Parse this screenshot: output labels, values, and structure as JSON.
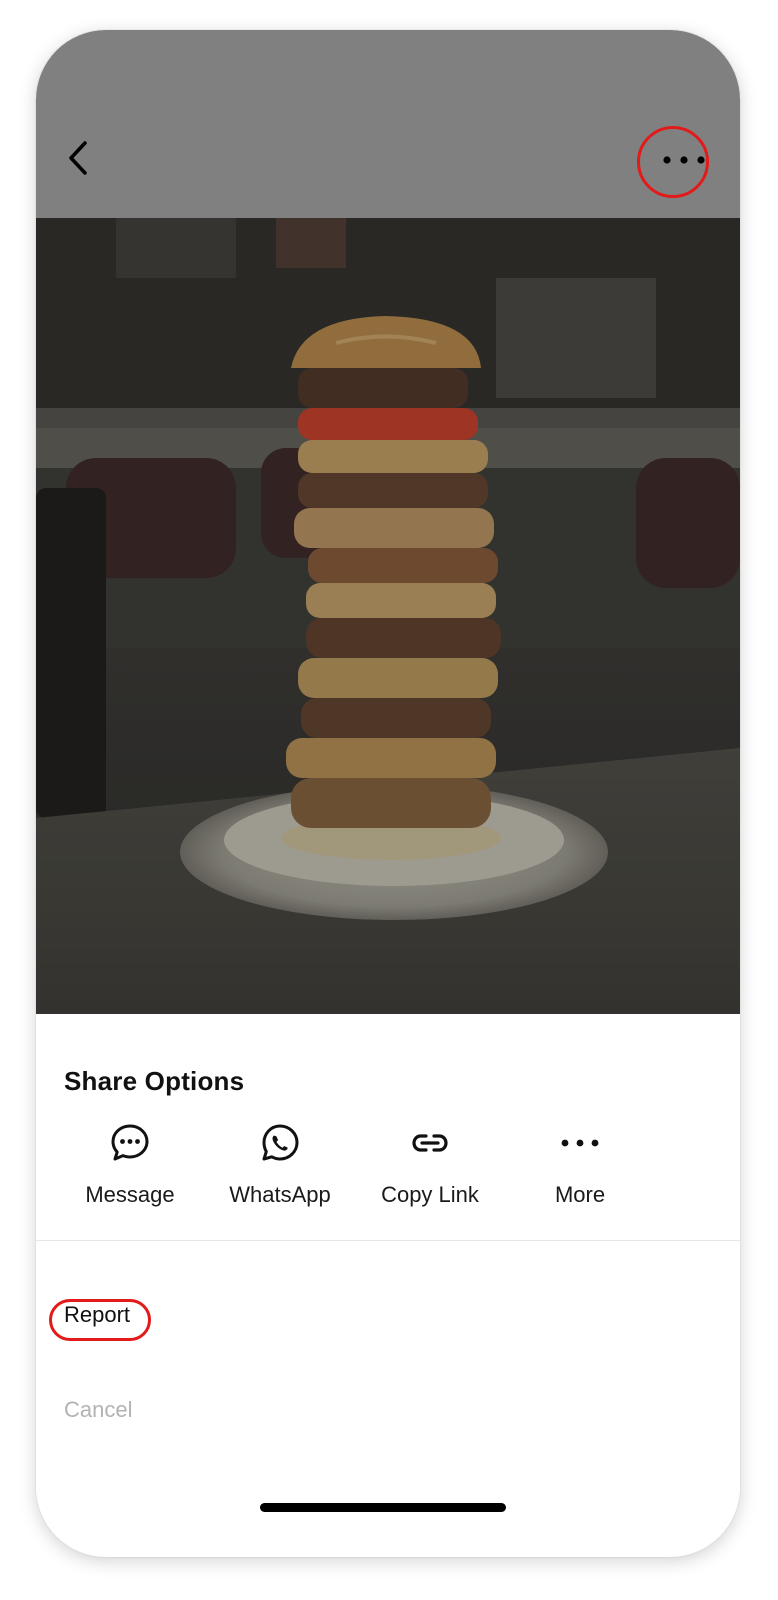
{
  "icons": {
    "back": "chevron-left-icon",
    "more": "more-horizontal-icon",
    "message": "message-bubble-icon",
    "whatsapp": "whatsapp-icon",
    "copy_link": "link-icon",
    "more_share": "more-horizontal-icon"
  },
  "colors": {
    "overlay_gray": "#808080",
    "highlight_red": "#e21a1a",
    "cancel_text": "#b3b3b3",
    "sheet_bg": "#ffffff"
  },
  "sheet": {
    "title": "Share Options",
    "share_options": [
      {
        "label": "Message"
      },
      {
        "label": "WhatsApp"
      },
      {
        "label": "Copy Link"
      },
      {
        "label": "More"
      }
    ],
    "report_label": "Report",
    "cancel_label": "Cancel"
  }
}
